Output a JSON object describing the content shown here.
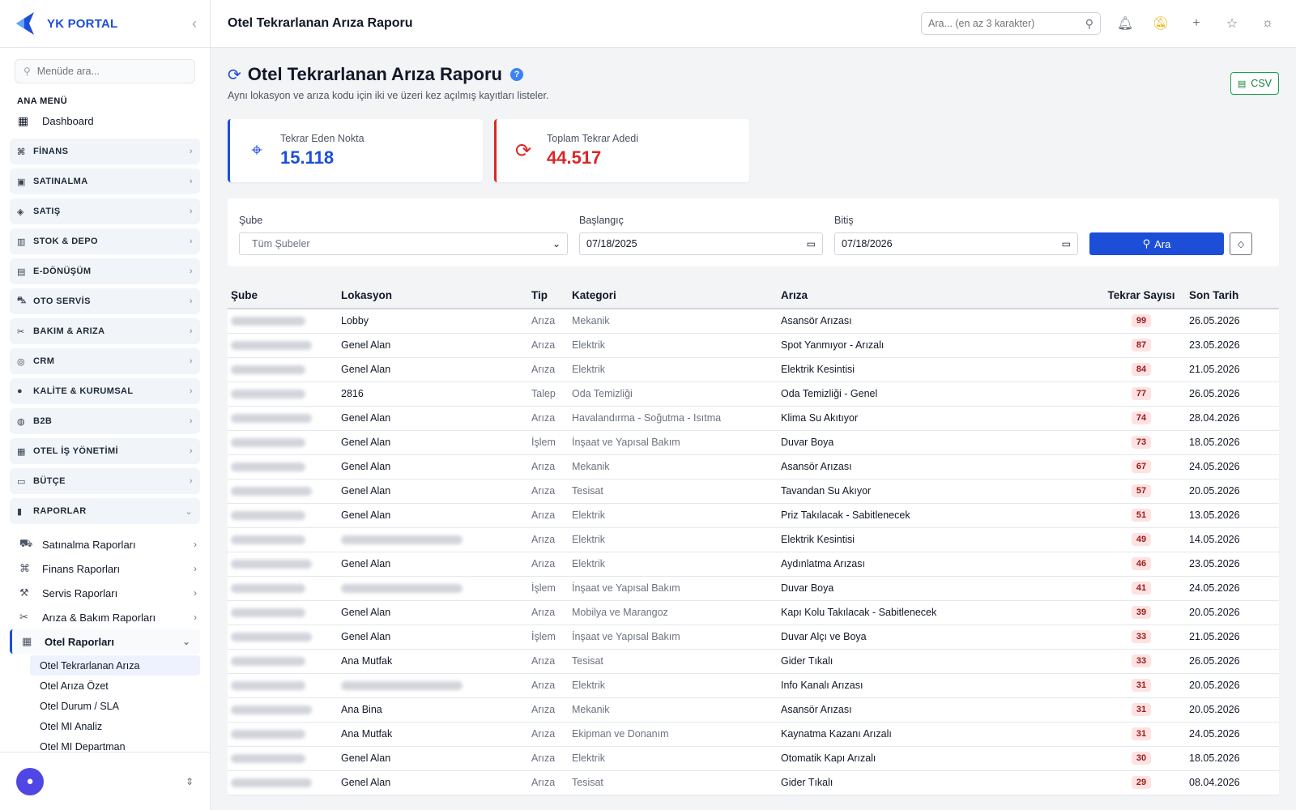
{
  "app": {
    "brand": "YK PORTAL"
  },
  "sidebar": {
    "search_placeholder": "Menüde ara...",
    "heading": "ANA MENÜ",
    "dashboard": "Dashboard",
    "sections": [
      {
        "label": "FİNANS",
        "icon": "finance-icon"
      },
      {
        "label": "SATINALMA",
        "icon": "bag-icon"
      },
      {
        "label": "SATIŞ",
        "icon": "tag-icon"
      },
      {
        "label": "STOK & DEPO",
        "icon": "box-icon"
      },
      {
        "label": "E-DÖNÜŞÜM",
        "icon": "document-icon"
      },
      {
        "label": "OTO SERVİS",
        "icon": "car-icon"
      },
      {
        "label": "BAKIM & ARIZA",
        "icon": "tools-icon"
      },
      {
        "label": "CRM",
        "icon": "headset-icon"
      },
      {
        "label": "KALİTE & KURUMSAL",
        "icon": "shield-icon"
      },
      {
        "label": "B2B",
        "icon": "globe-icon"
      },
      {
        "label": "OTEL İŞ YÖNETİMİ",
        "icon": "building-icon"
      },
      {
        "label": "BÜTÇE",
        "icon": "wallet-icon"
      },
      {
        "label": "RAPORLAR",
        "icon": "chart-icon"
      }
    ],
    "report_subs": [
      {
        "label": "Satınalma Raporları",
        "icon": "cart-icon"
      },
      {
        "label": "Finans Raporları",
        "icon": "finance-icon"
      },
      {
        "label": "Servis Raporları",
        "icon": "wrench-icon"
      },
      {
        "label": "Arıza & Bakım Raporları",
        "icon": "tools-icon"
      },
      {
        "label": "Otel Raporları",
        "icon": "building-icon"
      }
    ],
    "hotel_reports": [
      "Otel Tekrarlanan Arıza",
      "Otel Arıza Özet",
      "Otel Durum / SLA",
      "Otel MI Analiz",
      "Otel MI Departman"
    ]
  },
  "topbar": {
    "title": "Otel Tekrarlanan Arıza Raporu",
    "search_placeholder": "Ara... (en az 3 karakter)"
  },
  "page": {
    "title": "Otel Tekrarlanan Arıza Raporu",
    "description": "Aynı lokasyon ve arıza kodu için iki ve üzeri kez açılmış kayıtları listeler.",
    "csv_label": "CSV"
  },
  "kpis": {
    "points_label": "Tekrar Eden Nokta",
    "points_value": "15.118",
    "total_label": "Toplam Tekrar Adedi",
    "total_value": "44.517"
  },
  "filters": {
    "branch_label": "Şube",
    "branch_value": "Tüm Şubeler",
    "start_label": "Başlangıç",
    "start_value": "07/18/2025",
    "end_label": "Bitiş",
    "end_value": "07/18/2026",
    "search_label": "Ara"
  },
  "table": {
    "headers": [
      "Şube",
      "Lokasyon",
      "Tip",
      "Kategori",
      "Arıza",
      "Tekrar Sayısı",
      "Son Tarih"
    ],
    "rows": [
      {
        "location": "Lobby",
        "type": "Arıza",
        "category": "Mekanik",
        "fault": "Asansör Arızası",
        "count": "99",
        "date": "26.05.2026"
      },
      {
        "location": "Genel Alan",
        "type": "Arıza",
        "category": "Elektrik",
        "fault": "Spot Yanmıyor - Arızalı",
        "count": "87",
        "date": "23.05.2026"
      },
      {
        "location": "Genel Alan",
        "type": "Arıza",
        "category": "Elektrik",
        "fault": "Elektrik Kesintisi",
        "count": "84",
        "date": "21.05.2026"
      },
      {
        "location": "2816",
        "type": "Talep",
        "category": "Oda Temizliği",
        "fault": "Oda Temizliği - Genel",
        "count": "77",
        "date": "26.05.2026"
      },
      {
        "location": "Genel Alan",
        "type": "Arıza",
        "category": "Havalandırma - Soğutma - Isıtma",
        "fault": "Klima Su Akıtıyor",
        "count": "74",
        "date": "28.04.2026"
      },
      {
        "location": "Genel Alan",
        "type": "İşlem",
        "category": "İnşaat ve Yapısal Bakım",
        "fault": "Duvar Boya",
        "count": "73",
        "date": "18.05.2026"
      },
      {
        "location": "Genel Alan",
        "type": "Arıza",
        "category": "Mekanik",
        "fault": "Asansör Arızası",
        "count": "67",
        "date": "24.05.2026"
      },
      {
        "location": "Genel Alan",
        "type": "Arıza",
        "category": "Tesisat",
        "fault": "Tavandan Su Akıyor",
        "count": "57",
        "date": "20.05.2026"
      },
      {
        "location": "Genel Alan",
        "type": "Arıza",
        "category": "Elektrik",
        "fault": "Priz Takılacak - Sabitlenecek",
        "count": "51",
        "date": "13.05.2026"
      },
      {
        "location": "",
        "type": "Arıza",
        "category": "Elektrik",
        "fault": "Elektrik Kesintisi",
        "count": "49",
        "date": "14.05.2026"
      },
      {
        "location": "Genel Alan",
        "type": "Arıza",
        "category": "Elektrik",
        "fault": "Aydınlatma Arızası",
        "count": "46",
        "date": "23.05.2026"
      },
      {
        "location": "",
        "type": "İşlem",
        "category": "İnşaat ve Yapısal Bakım",
        "fault": "Duvar Boya",
        "count": "41",
        "date": "24.05.2026"
      },
      {
        "location": "Genel Alan",
        "type": "Arıza",
        "category": "Mobilya ve Marangoz",
        "fault": "Kapı Kolu Takılacak - Sabitlenecek",
        "count": "39",
        "date": "20.05.2026"
      },
      {
        "location": "Genel Alan",
        "type": "İşlem",
        "category": "İnşaat ve Yapısal Bakım",
        "fault": "Duvar Alçı ve Boya",
        "count": "33",
        "date": "21.05.2026"
      },
      {
        "location": "Ana Mutfak",
        "type": "Arıza",
        "category": "Tesisat",
        "fault": "Gider Tıkalı",
        "count": "33",
        "date": "26.05.2026"
      },
      {
        "location": "",
        "type": "Arıza",
        "category": "Elektrik",
        "fault": "Info Kanalı Arızası",
        "count": "31",
        "date": "20.05.2026"
      },
      {
        "location": "Ana Bina",
        "type": "Arıza",
        "category": "Mekanik",
        "fault": "Asansör Arızası",
        "count": "31",
        "date": "20.05.2026"
      },
      {
        "location": "Ana Mutfak",
        "type": "Arıza",
        "category": "Ekipman ve Donanım",
        "fault": "Kaynatma Kazanı Arızalı",
        "count": "31",
        "date": "24.05.2026"
      },
      {
        "location": "Genel Alan",
        "type": "Arıza",
        "category": "Elektrik",
        "fault": "Otomatik Kapı Arızalı",
        "count": "30",
        "date": "18.05.2026"
      },
      {
        "location": "Genel Alan",
        "type": "Arıza",
        "category": "Tesisat",
        "fault": "Gider Tıkalı",
        "count": "29",
        "date": "08.04.2026"
      }
    ]
  },
  "colors": {
    "accent": "#1d4ed8",
    "danger": "#dc2626",
    "success": "#16a34a"
  }
}
